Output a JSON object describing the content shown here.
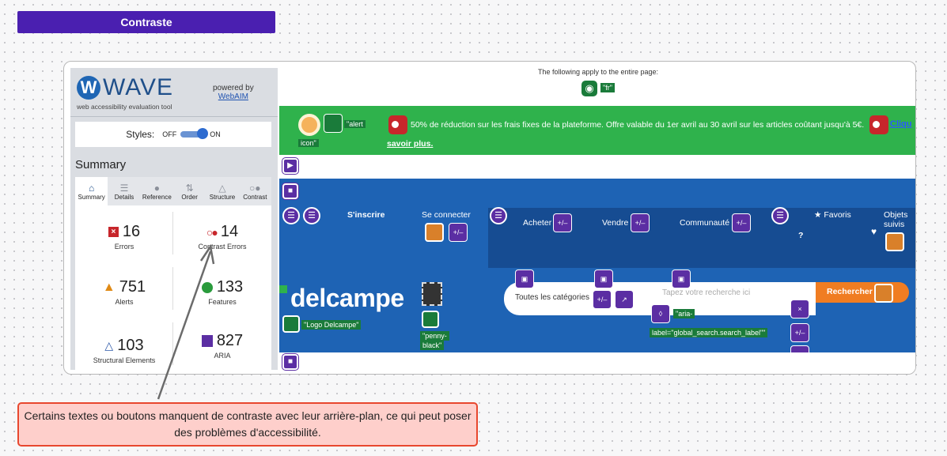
{
  "title": "Contraste",
  "wave": {
    "logo_letter": "W",
    "logo_word": "WAVE",
    "tagline": "web accessibility evaluation tool",
    "powered_by": "powered by",
    "powered_link": "WebAIM",
    "styles_label": "Styles:",
    "styles_off": "OFF",
    "styles_on": "ON",
    "summary_heading": "Summary",
    "tabs": [
      {
        "label": "Summary",
        "icon": "home-icon"
      },
      {
        "label": "Details",
        "icon": "list-icon"
      },
      {
        "label": "Reference",
        "icon": "info-icon"
      },
      {
        "label": "Order",
        "icon": "order-icon"
      },
      {
        "label": "Structure",
        "icon": "structure-icon"
      },
      {
        "label": "Contrast",
        "icon": "contrast-icon"
      }
    ],
    "stats": {
      "errors": {
        "value": "16",
        "label": "Errors"
      },
      "contrast": {
        "value": "14",
        "label": "Contrast Errors"
      },
      "alerts": {
        "value": "751",
        "label": "Alerts"
      },
      "features": {
        "value": "133",
        "label": "Features"
      },
      "structural": {
        "value": "103",
        "label": "Structural Elements"
      },
      "aria": {
        "value": "827",
        "label": "ARIA"
      }
    }
  },
  "page": {
    "notice": "The following apply to the entire page:",
    "lang_tag": "\"fr\"",
    "alt_alert": "\"alert",
    "alt_icon": "icon\"",
    "promo_text": "50% de réduction sur les frais fixes de la plateforme. Offre valable du 1er avril au 30 avril sur les articles coûtant jusqu'à 5€.",
    "promo_link_start": "Cliqu",
    "promo_link": "savoir plus.",
    "nav": {
      "signup": "S'inscrire",
      "login": "Se connecter",
      "buy": "Acheter",
      "sell": "Vendre",
      "community": "Communauté",
      "favorites": "Favoris",
      "followed_1": "Objets",
      "followed_2": "suivis",
      "help": "?"
    },
    "logo_text": "delcampe",
    "logo_alt": "\"Logo Delcampe\"",
    "penny_1": "\"penny-",
    "penny_2": "black\"",
    "categories": "Toutes les catégories",
    "search_placeholder": "Tapez votre recherche ici",
    "aria_label_1": "\"aria-",
    "aria_label_2": "label=\"global_search.search_label\"\"",
    "search_button": "Rechercher"
  },
  "callout": "Certains textes ou boutons manquent de contraste avec leur arrière-plan, ce qui peut poser des problèmes d'accessibilité.",
  "colors": {
    "accent": "#4a1fb0",
    "callout_border": "#e8472e",
    "callout_bg": "#fecfcb"
  }
}
